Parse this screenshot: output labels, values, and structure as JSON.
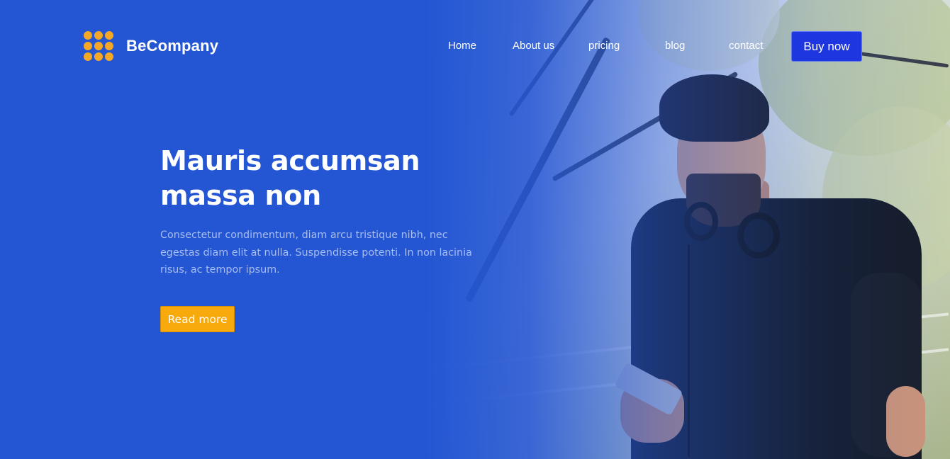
{
  "brand": {
    "name": "BeCompany",
    "logo_icon": "dots-grid-logo-icon",
    "logo_color": "#f4a825"
  },
  "nav": {
    "items": [
      {
        "label": "Home"
      },
      {
        "label": "About us"
      },
      {
        "label": "pricing"
      },
      {
        "label": "blog"
      },
      {
        "label": "contact"
      }
    ],
    "cta_label": "Buy now",
    "cta_color": "#1d36e0"
  },
  "hero": {
    "title": "Mauris accumsan massa non",
    "text": "Consectetur condimentum, diam arcu tristique nibh, nec egestas diam elit at nulla. Suspendisse potenti. In non lacinia risus, ac tempor ipsum.",
    "button_label": "Read more",
    "button_color": "#f8a90b",
    "background_color": "#2456d3"
  }
}
